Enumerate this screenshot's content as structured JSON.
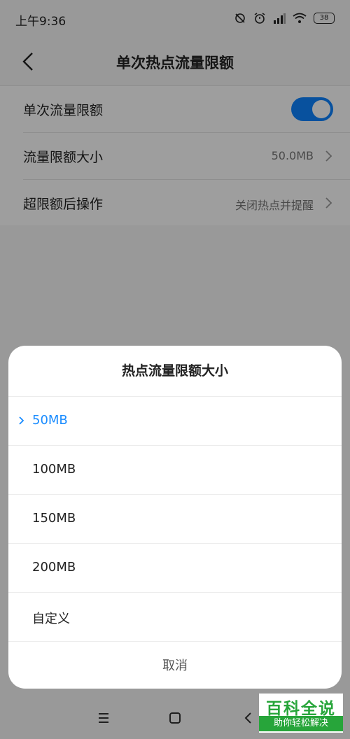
{
  "status_bar": {
    "time": "上午9:36",
    "battery": "38"
  },
  "header": {
    "title": "单次热点流量限额"
  },
  "settings": {
    "rows": [
      {
        "label": "单次流量限额",
        "toggle_on": true
      },
      {
        "label": "流量限额大小",
        "value": "50.0MB"
      },
      {
        "label": "超限额后操作",
        "value": "关闭热点并提醒"
      }
    ]
  },
  "dialog": {
    "title": "热点流量限额大小",
    "options": [
      {
        "label": "50MB",
        "selected": true
      },
      {
        "label": "100MB",
        "selected": false
      },
      {
        "label": "150MB",
        "selected": false
      },
      {
        "label": "200MB",
        "selected": false
      },
      {
        "label": "自定义",
        "selected": false
      }
    ],
    "cancel": "取消"
  },
  "navbar": {
    "icons": [
      "menu-icon",
      "home-icon",
      "back-icon"
    ]
  },
  "watermark": {
    "top": "百科全说",
    "bottom": "助你轻松解决"
  },
  "colors": {
    "accent": "#0d84ff",
    "selected_text": "#1a8cff",
    "watermark_green": "#27a53a"
  }
}
